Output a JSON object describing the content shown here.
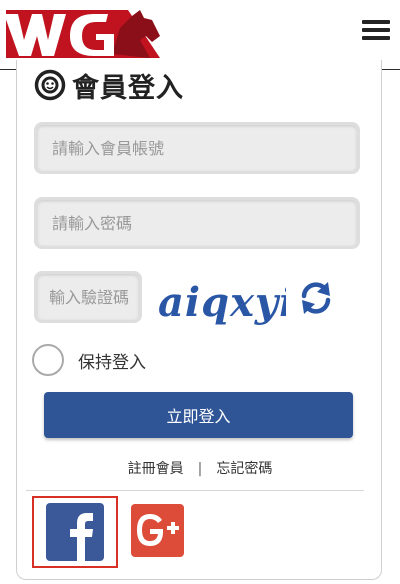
{
  "header": {
    "logo_text": "WG",
    "menu_icon": "hamburger-icon"
  },
  "login": {
    "title": "會員登入",
    "title_icon": "smiley-icon",
    "account_placeholder": "請輸入會員帳號",
    "password_placeholder": "請輸入密碼",
    "captcha_placeholder": "輸入驗證碼",
    "captcha_text": "aiqxyi",
    "refresh_icon": "refresh-icon",
    "remember_label": "保持登入",
    "submit_label": "立即登入",
    "register_link": "註冊會員",
    "separator": "|",
    "forgot_link": "忘記密碼"
  },
  "social": {
    "facebook_icon": "facebook-icon",
    "google_plus_icon": "google-plus-icon"
  },
  "colors": {
    "brand_red": "#c1121f",
    "button_blue": "#2f5597",
    "captcha_blue": "#2a56a6",
    "facebook": "#3b5998",
    "google_plus": "#dd4b39"
  }
}
